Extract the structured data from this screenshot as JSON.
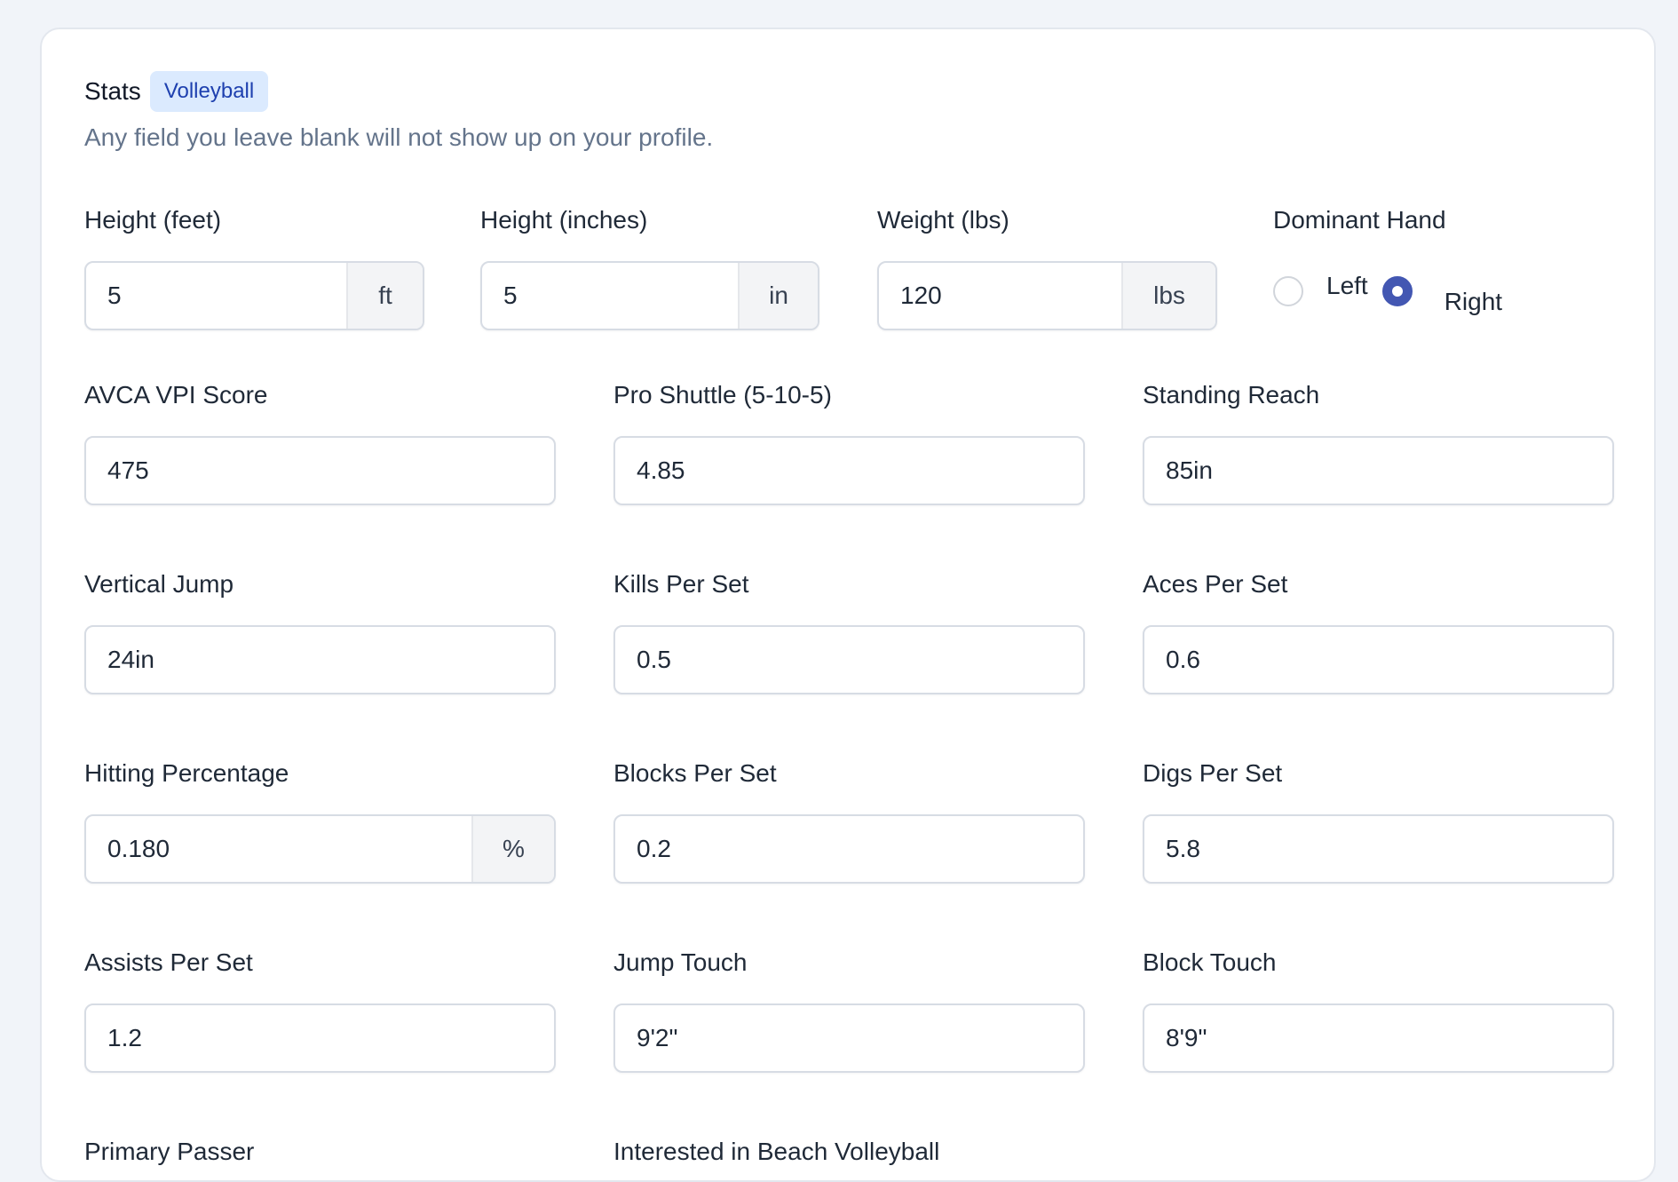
{
  "header": {
    "title": "Stats",
    "sport_badge": "Volleyball",
    "subtitle": "Any field you leave blank will not show up on your profile."
  },
  "fields": {
    "height_feet": {
      "label": "Height (feet)",
      "value": "5",
      "unit": "ft"
    },
    "height_inches": {
      "label": "Height (inches)",
      "value": "5",
      "unit": "in"
    },
    "weight": {
      "label": "Weight (lbs)",
      "value": "120",
      "unit": "lbs"
    },
    "dominant_hand": {
      "label": "Dominant Hand",
      "options": [
        "Left",
        "Right"
      ],
      "selected": "Right"
    },
    "avca_vpi": {
      "label": "AVCA VPI Score",
      "value": "475"
    },
    "pro_shuttle": {
      "label": "Pro Shuttle (5-10-5)",
      "value": "4.85"
    },
    "standing_reach": {
      "label": "Standing Reach",
      "value": "85in"
    },
    "vertical_jump": {
      "label": "Vertical Jump",
      "value": "24in"
    },
    "kills_per_set": {
      "label": "Kills Per Set",
      "value": "0.5"
    },
    "aces_per_set": {
      "label": "Aces Per Set",
      "value": "0.6"
    },
    "hitting_percentage": {
      "label": "Hitting Percentage",
      "value": "0.180",
      "unit": "%"
    },
    "blocks_per_set": {
      "label": "Blocks Per Set",
      "value": "0.2"
    },
    "digs_per_set": {
      "label": "Digs Per Set",
      "value": "5.8"
    },
    "assists_per_set": {
      "label": "Assists Per Set",
      "value": "1.2"
    },
    "jump_touch": {
      "label": "Jump Touch",
      "value": "9'2\""
    },
    "block_touch": {
      "label": "Block Touch",
      "value": "8'9\""
    },
    "primary_passer": {
      "label": "Primary Passer"
    },
    "beach_interest": {
      "label": "Interested in Beach Volleyball"
    }
  },
  "colors": {
    "page_background": "#f1f4f9",
    "badge_background": "#dbeafe",
    "badge_text": "#1e40af",
    "radio_selected": "#4357b2",
    "addon_background": "#f3f4f6"
  }
}
